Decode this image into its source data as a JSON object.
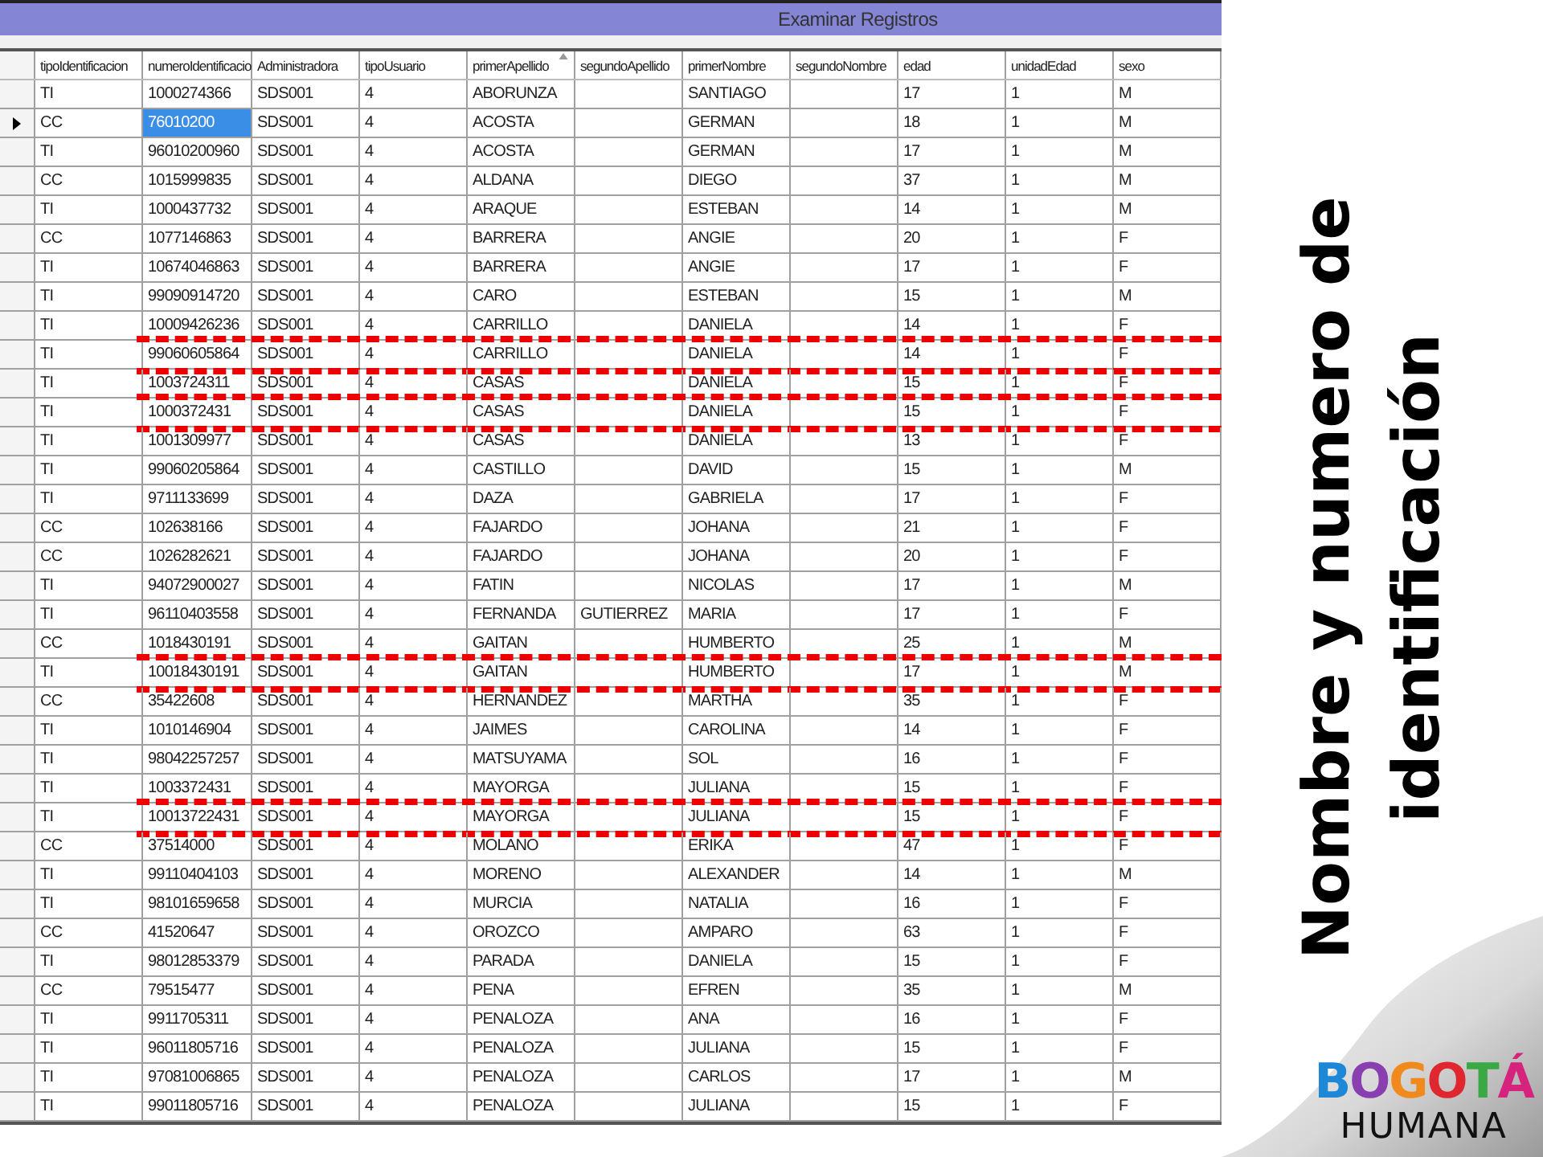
{
  "window": {
    "title": "Examinar Registros"
  },
  "table": {
    "columns": [
      {
        "label": "tipoIdentificacion",
        "sorted": false
      },
      {
        "label": "numeroIdentificacio",
        "sorted": false
      },
      {
        "label": "Administradora",
        "sorted": false
      },
      {
        "label": "tipoUsuario",
        "sorted": false
      },
      {
        "label": "primerApellido",
        "sorted": true
      },
      {
        "label": "segundoApellido",
        "sorted": false
      },
      {
        "label": "primerNombre",
        "sorted": false
      },
      {
        "label": "segundoNombre",
        "sorted": false
      },
      {
        "label": "edad",
        "sorted": false
      },
      {
        "label": "unidadEdad",
        "sorted": false
      },
      {
        "label": "sexo",
        "sorted": false
      }
    ],
    "rows": [
      {
        "cells": [
          "TI",
          "1000274366",
          "SDS001",
          "4",
          "ABORUNZA",
          null,
          "SANTIAGO",
          null,
          "17",
          "1",
          "M"
        ],
        "selected": false,
        "highlighted": false
      },
      {
        "cells": [
          "CC",
          "76010200",
          "SDS001",
          "4",
          "ACOSTA",
          null,
          "GERMAN",
          null,
          "18",
          "1",
          "M"
        ],
        "selected": true,
        "highlighted": false
      },
      {
        "cells": [
          "TI",
          "96010200960",
          "SDS001",
          "4",
          "ACOSTA",
          null,
          "GERMAN",
          null,
          "17",
          "1",
          "M"
        ],
        "selected": false,
        "highlighted": false
      },
      {
        "cells": [
          "CC",
          "1015999835",
          "SDS001",
          "4",
          "ALDANA",
          null,
          "DIEGO",
          null,
          "37",
          "1",
          "M"
        ],
        "selected": false,
        "highlighted": false
      },
      {
        "cells": [
          "TI",
          "1000437732",
          "SDS001",
          "4",
          "ARAQUE",
          null,
          "ESTEBAN",
          null,
          "14",
          "1",
          "M"
        ],
        "selected": false,
        "highlighted": false
      },
      {
        "cells": [
          "CC",
          "1077146863",
          "SDS001",
          "4",
          "BARRERA",
          null,
          "ANGIE",
          null,
          "20",
          "1",
          "F"
        ],
        "selected": false,
        "highlighted": false
      },
      {
        "cells": [
          "TI",
          "10674046863",
          "SDS001",
          "4",
          "BARRERA",
          null,
          "ANGIE",
          null,
          "17",
          "1",
          "F"
        ],
        "selected": false,
        "highlighted": false
      },
      {
        "cells": [
          "TI",
          "99090914720",
          "SDS001",
          "4",
          "CARO",
          null,
          "ESTEBAN",
          null,
          "15",
          "1",
          "M"
        ],
        "selected": false,
        "highlighted": false
      },
      {
        "cells": [
          "TI",
          "10009426236",
          "SDS001",
          "4",
          "CARRILLO",
          null,
          "DANIELA",
          null,
          "14",
          "1",
          "F"
        ],
        "selected": false,
        "highlighted": false
      },
      {
        "cells": [
          "TI",
          "99060605864",
          "SDS001",
          "4",
          "CARRILLO",
          null,
          "DANIELA",
          null,
          "14",
          "1",
          "F"
        ],
        "selected": false,
        "highlighted": true
      },
      {
        "cells": [
          "TI",
          "1003724311",
          "SDS001",
          "4",
          "CASAS",
          null,
          "DANIELA",
          null,
          "15",
          "1",
          "F"
        ],
        "selected": false,
        "highlighted": false
      },
      {
        "cells": [
          "TI",
          "1000372431",
          "SDS001",
          "4",
          "CASAS",
          null,
          "DANIELA",
          null,
          "15",
          "1",
          "F"
        ],
        "selected": false,
        "highlighted": true
      },
      {
        "cells": [
          "TI",
          "1001309977",
          "SDS001",
          "4",
          "CASAS",
          null,
          "DANIELA",
          null,
          "13",
          "1",
          "F"
        ],
        "selected": false,
        "highlighted": false
      },
      {
        "cells": [
          "TI",
          "99060205864",
          "SDS001",
          "4",
          "CASTILLO",
          null,
          "DAVID",
          null,
          "15",
          "1",
          "M"
        ],
        "selected": false,
        "highlighted": false
      },
      {
        "cells": [
          "TI",
          "9711133699",
          "SDS001",
          "4",
          "DAZA",
          null,
          "GABRIELA",
          null,
          "17",
          "1",
          "F"
        ],
        "selected": false,
        "highlighted": false
      },
      {
        "cells": [
          "CC",
          "102638166",
          "SDS001",
          "4",
          "FAJARDO",
          null,
          "JOHANA",
          null,
          "21",
          "1",
          "F"
        ],
        "selected": false,
        "highlighted": false
      },
      {
        "cells": [
          "CC",
          "1026282621",
          "SDS001",
          "4",
          "FAJARDO",
          null,
          "JOHANA",
          null,
          "20",
          "1",
          "F"
        ],
        "selected": false,
        "highlighted": false
      },
      {
        "cells": [
          "TI",
          "94072900027",
          "SDS001",
          "4",
          "FATIN",
          null,
          "NICOLAS",
          null,
          "17",
          "1",
          "M"
        ],
        "selected": false,
        "highlighted": false
      },
      {
        "cells": [
          "TI",
          "96110403558",
          "SDS001",
          "4",
          "FERNANDA",
          "GUTIERREZ",
          "MARIA",
          null,
          "17",
          "1",
          "F"
        ],
        "selected": false,
        "highlighted": false
      },
      {
        "cells": [
          "CC",
          "1018430191",
          "SDS001",
          "4",
          "GAITAN",
          null,
          "HUMBERTO",
          null,
          "25",
          "1",
          "M"
        ],
        "selected": false,
        "highlighted": false
      },
      {
        "cells": [
          "TI",
          "10018430191",
          "SDS001",
          "4",
          "GAITAN",
          null,
          "HUMBERTO",
          null,
          "17",
          "1",
          "M"
        ],
        "selected": false,
        "highlighted": true
      },
      {
        "cells": [
          "CC",
          "35422608",
          "SDS001",
          "4",
          "HERNANDEZ",
          null,
          "MARTHA",
          null,
          "35",
          "1",
          "F"
        ],
        "selected": false,
        "highlighted": false
      },
      {
        "cells": [
          "TI",
          "1010146904",
          "SDS001",
          "4",
          "JAIMES",
          null,
          "CAROLINA",
          null,
          "14",
          "1",
          "F"
        ],
        "selected": false,
        "highlighted": false
      },
      {
        "cells": [
          "TI",
          "98042257257",
          "SDS001",
          "4",
          "MATSUYAMA",
          null,
          "SOL",
          null,
          "16",
          "1",
          "F"
        ],
        "selected": false,
        "highlighted": false
      },
      {
        "cells": [
          "TI",
          "1003372431",
          "SDS001",
          "4",
          "MAYORGA",
          null,
          "JULIANA",
          null,
          "15",
          "1",
          "F"
        ],
        "selected": false,
        "highlighted": false
      },
      {
        "cells": [
          "TI",
          "10013722431",
          "SDS001",
          "4",
          "MAYORGA",
          null,
          "JULIANA",
          null,
          "15",
          "1",
          "F"
        ],
        "selected": false,
        "highlighted": true
      },
      {
        "cells": [
          "CC",
          "37514000",
          "SDS001",
          "4",
          "MOLANO",
          null,
          "ERIKA",
          null,
          "47",
          "1",
          "F"
        ],
        "selected": false,
        "highlighted": false
      },
      {
        "cells": [
          "TI",
          "99110404103",
          "SDS001",
          "4",
          "MORENO",
          null,
          "ALEXANDER",
          null,
          "14",
          "1",
          "M"
        ],
        "selected": false,
        "highlighted": false
      },
      {
        "cells": [
          "TI",
          "98101659658",
          "SDS001",
          "4",
          "MURCIA",
          null,
          "NATALIA",
          null,
          "16",
          "1",
          "F"
        ],
        "selected": false,
        "highlighted": false
      },
      {
        "cells": [
          "CC",
          "41520647",
          "SDS001",
          "4",
          "OROZCO",
          null,
          "AMPARO",
          null,
          "63",
          "1",
          "F"
        ],
        "selected": false,
        "highlighted": false
      },
      {
        "cells": [
          "TI",
          "98012853379",
          "SDS001",
          "4",
          "PARADA",
          null,
          "DANIELA",
          null,
          "15",
          "1",
          "F"
        ],
        "selected": false,
        "highlighted": false
      },
      {
        "cells": [
          "CC",
          "79515477",
          "SDS001",
          "4",
          "PENA",
          null,
          "EFREN",
          null,
          "35",
          "1",
          "M"
        ],
        "selected": false,
        "highlighted": false
      },
      {
        "cells": [
          "TI",
          "9911705311",
          "SDS001",
          "4",
          "PENALOZA",
          null,
          "ANA",
          null,
          "16",
          "1",
          "F"
        ],
        "selected": false,
        "highlighted": false
      },
      {
        "cells": [
          "TI",
          "96011805716",
          "SDS001",
          "4",
          "PENALOZA",
          null,
          "JULIANA",
          null,
          "15",
          "1",
          "F"
        ],
        "selected": false,
        "highlighted": false
      },
      {
        "cells": [
          "TI",
          "97081006865",
          "SDS001",
          "4",
          "PENALOZA",
          null,
          "CARLOS",
          null,
          "17",
          "1",
          "M"
        ],
        "selected": false,
        "highlighted": false
      },
      {
        "cells": [
          "TI",
          "99011805716",
          "SDS001",
          "4",
          "PENALOZA",
          null,
          "JULIANA",
          null,
          "15",
          "1",
          "F"
        ],
        "selected": false,
        "highlighted": false
      }
    ]
  },
  "slide_title": "Nombre y numero de identificación",
  "logo": {
    "letters": [
      {
        "text": "B",
        "color": "#1e88d8"
      },
      {
        "text": "O",
        "color": "#8a3fb0"
      },
      {
        "text": "G",
        "color": "#f08a1c"
      },
      {
        "text": "O",
        "color": "#e0262e"
      },
      {
        "text": "T",
        "color": "#3aa845"
      },
      {
        "text": "Á",
        "color": "#d6247e"
      }
    ],
    "subtitle": "HUMANA"
  }
}
